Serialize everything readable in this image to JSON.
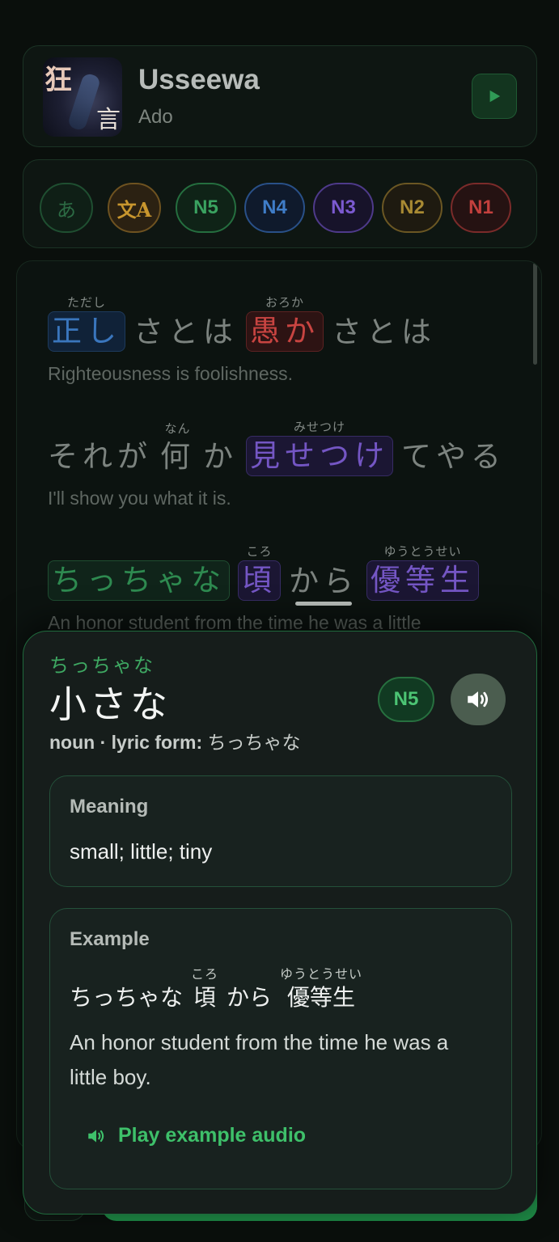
{
  "song": {
    "title": "Usseewa",
    "artist": "Ado",
    "art_text_top": "狂",
    "art_text_bottom": "言"
  },
  "filters": {
    "kana": "あ",
    "translate": "文A",
    "levels": [
      "N5",
      "N4",
      "N3",
      "N2",
      "N1"
    ]
  },
  "lyrics": [
    {
      "words": [
        {
          "text": "正し",
          "ruby": "ただし",
          "style": "blue"
        },
        {
          "text": "さとは",
          "ruby": "",
          "style": "plain"
        },
        {
          "text": "愚か",
          "ruby": "おろか",
          "style": "red"
        },
        {
          "text": "さとは",
          "ruby": "",
          "style": "plain"
        }
      ],
      "translation": "Righteousness is foolishness."
    },
    {
      "words": [
        {
          "text": "それが",
          "ruby": "",
          "style": "plain"
        },
        {
          "text": "何",
          "ruby": "なん",
          "style": "plain"
        },
        {
          "text": "か",
          "ruby": "",
          "style": "plain"
        },
        {
          "text": "見せつけ",
          "ruby": "みせつけ",
          "style": "purple"
        },
        {
          "text": "てやる",
          "ruby": "",
          "style": "plain"
        }
      ],
      "translation": "I'll show you what it is."
    },
    {
      "words": [
        {
          "text": "ちっちゃな",
          "ruby": "",
          "style": "green"
        },
        {
          "text": "頃",
          "ruby": "ころ",
          "style": "purple"
        },
        {
          "text": "から",
          "ruby": "",
          "style": "plain"
        },
        {
          "text": "優等生",
          "ruby": "ゆうとうせい",
          "style": "purple"
        }
      ],
      "translation": "An honor student from the time he was a little"
    }
  ],
  "popup": {
    "reading": "ちっちゃな",
    "word": "小さな",
    "pos": "noun · lyric form:",
    "lyric_form": "ちっちゃな",
    "level": "N5",
    "audio_icon": "speaker-icon",
    "meaning_title": "Meaning",
    "meaning": "small; little; tiny",
    "example_title": "Example",
    "example_words": [
      {
        "text": "ちっちゃな",
        "ruby": ""
      },
      {
        "text": "頃",
        "ruby": "ころ"
      },
      {
        "text": "から",
        "ruby": ""
      },
      {
        "text": "優等生",
        "ruby": "ゆうとうせい"
      }
    ],
    "example_translation": "An honor student from the time he was a little boy.",
    "play_example": "Play example audio"
  },
  "colors": {
    "accent_green": "#3ec06a",
    "background": "#0a0f0c",
    "n5": "#3aa260",
    "n4": "#3f7dc8",
    "n3": "#7b5ad0",
    "n2": "#a88a33",
    "n1": "#c3403d"
  }
}
